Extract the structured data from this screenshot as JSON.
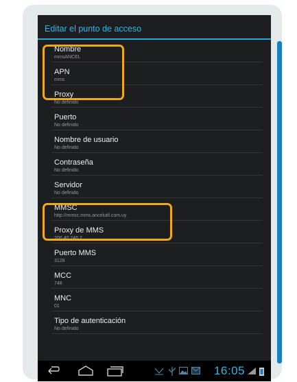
{
  "dialog": {
    "title": "Editar el punto de acceso",
    "accent_color": "#34b5e5"
  },
  "settings": [
    {
      "label": "Nombre",
      "value": "mmsANCEL"
    },
    {
      "label": "APN",
      "value": "mms"
    },
    {
      "label": "Proxy",
      "value": "No definido"
    },
    {
      "label": "Puerto",
      "value": "No definido"
    },
    {
      "label": "Nombre de usuario",
      "value": "No definido"
    },
    {
      "label": "Contraseña",
      "value": "No definido"
    },
    {
      "label": "Servidor",
      "value": "No definido"
    },
    {
      "label": "MMSC",
      "value": "http://mmsc.mms.ancelutil.com.uy"
    },
    {
      "label": "Proxy de MMS",
      "value": "200.40.246.2"
    },
    {
      "label": "Puerto MMS",
      "value": "3128"
    },
    {
      "label": "MCC",
      "value": "748"
    },
    {
      "label": "MNC",
      "value": "01"
    },
    {
      "label": "Tipo de autenticación",
      "value": "No definido"
    }
  ],
  "highlight_color": "#f0a81c",
  "navbar": {
    "clock": "16:05",
    "icons": [
      "back-icon",
      "home-icon",
      "recent-apps-icon",
      "dropdown-icon",
      "usb-icon",
      "image-icon",
      "mail-icon",
      "signal-icon",
      "battery-icon"
    ]
  }
}
